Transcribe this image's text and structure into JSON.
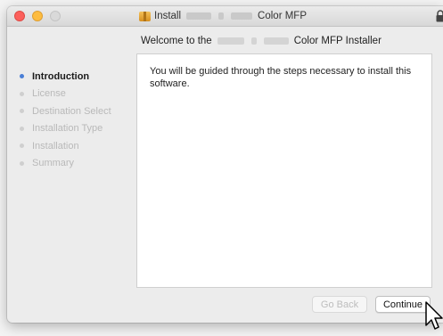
{
  "window": {
    "title_prefix": "Install",
    "title_suffix": "Color MFP",
    "subtitle_prefix": "Welcome to the",
    "subtitle_suffix": "Color MFP Installer"
  },
  "steps": [
    {
      "label": "Introduction",
      "active": true
    },
    {
      "label": "License",
      "active": false
    },
    {
      "label": "Destination Select",
      "active": false
    },
    {
      "label": "Installation Type",
      "active": false
    },
    {
      "label": "Installation",
      "active": false
    },
    {
      "label": "Summary",
      "active": false
    }
  ],
  "content": {
    "text": "You will be guided through the steps necessary to install this software."
  },
  "buttons": {
    "back": "Go Back",
    "continue": "Continue"
  },
  "icons": [
    "package-icon",
    "lock-icon",
    "mouse-pointer-icon"
  ],
  "colors": {
    "active_bullet": "#4a7fd6",
    "close": "#fc605c",
    "minimize": "#fdbc40"
  }
}
